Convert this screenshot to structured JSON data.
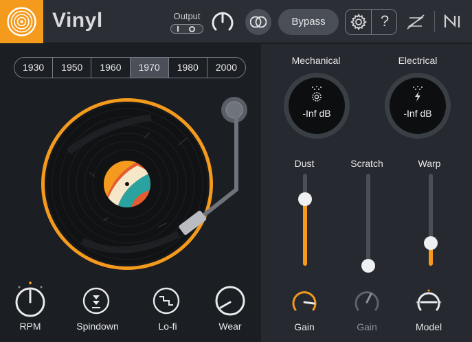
{
  "header": {
    "title": "Vinyl",
    "output_label": "Output",
    "bypass_label": "Bypass",
    "help_label": "?",
    "logo_icon": "vinyl-record-icon",
    "accent_color": "#f49a1d"
  },
  "eras": {
    "items": [
      "1930",
      "1950",
      "1960",
      "1970",
      "1980",
      "2000"
    ],
    "selected": "1970"
  },
  "turntable_knobs": [
    {
      "label": "RPM",
      "icon": "rpm-knob-icon"
    },
    {
      "label": "Spindown",
      "icon": "spindown-icon"
    },
    {
      "label": "Lo-fi",
      "icon": "lofi-step-icon"
    },
    {
      "label": "Wear",
      "icon": "wear-knob-icon"
    }
  ],
  "meters": [
    {
      "label": "Mechanical",
      "value": "-Inf dB",
      "icon": "gear-noise-icon"
    },
    {
      "label": "Electrical",
      "value": "-Inf dB",
      "icon": "lightning-noise-icon"
    }
  ],
  "sliders": [
    {
      "label": "Dust",
      "level_percent": 78
    },
    {
      "label": "Scratch",
      "level_percent": 0
    },
    {
      "label": "Warp",
      "level_percent": 27
    }
  ],
  "bottom_knobs": [
    {
      "label": "Gain",
      "icon": "gain-knob-icon",
      "enabled": true
    },
    {
      "label": "Gain",
      "icon": "gain-knob-icon",
      "enabled": false
    },
    {
      "label": "Model",
      "icon": "model-knob-icon",
      "enabled": true
    }
  ]
}
